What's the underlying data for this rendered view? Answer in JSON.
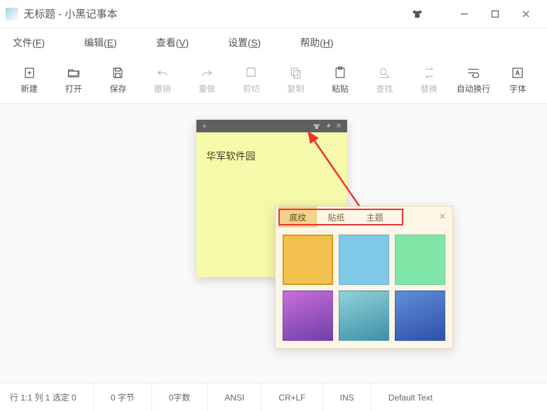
{
  "titlebar": {
    "text": "无标题 - 小黑记事本"
  },
  "menu": {
    "file": {
      "label": "文件(",
      "accel": "F",
      "tail": ")"
    },
    "edit": {
      "label": "编辑(",
      "accel": "E",
      "tail": ")"
    },
    "view": {
      "label": "查看(",
      "accel": "V",
      "tail": ")"
    },
    "setup": {
      "label": "设置(",
      "accel": "S",
      "tail": ")"
    },
    "help": {
      "label": "帮助(",
      "accel": "H",
      "tail": ")"
    }
  },
  "toolbar": {
    "new": "新建",
    "open": "打开",
    "save": "保存",
    "undo": "撤销",
    "redo": "重做",
    "cut": "剪切",
    "copy": "复制",
    "paste": "粘贴",
    "find": "查找",
    "replace": "替换",
    "wrap": "自动换行",
    "font": "字体"
  },
  "sticky": {
    "text": "华军软件园"
  },
  "panel": {
    "tabs": {
      "texture": "底纹",
      "sticker": "贴纸",
      "theme": "主题"
    },
    "swatches": [
      "orange",
      "light-blue",
      "light-green",
      "purple-gradient",
      "teal-gradient",
      "blue-gradient"
    ]
  },
  "status": {
    "pos": "行 1:1  列 1  选定 0",
    "bytes": "0 字节",
    "chars": "0字数",
    "enc": "ANSI",
    "eol": "CR+LF",
    "mode": "INS",
    "theme": "Default Text"
  }
}
